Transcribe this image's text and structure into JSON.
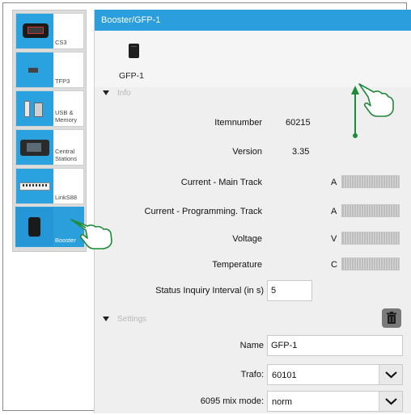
{
  "sidebar": {
    "items": [
      {
        "label": "CS3",
        "icon": "cs3-device-icon",
        "active": false
      },
      {
        "label": "TFP3",
        "icon": "tfp3-device-icon",
        "active": false
      },
      {
        "label": "USB & Memory",
        "icon": "usb-memory-icon",
        "active": false
      },
      {
        "label": "Central Stations",
        "icon": "central-station-icon",
        "active": false
      },
      {
        "label": "LinkS88",
        "icon": "links88-icon",
        "active": false
      },
      {
        "label": "Booster",
        "icon": "booster-icon",
        "active": true
      }
    ]
  },
  "header": {
    "title": "Booster/GFP-1"
  },
  "device": {
    "name": "GFP-1"
  },
  "info": {
    "section_label": "Info",
    "itemnumber_label": "Itemnumber",
    "itemnumber_value": "60215",
    "version_label": "Version",
    "version_value": "3.35",
    "current_main_label": "Current - Main Track",
    "current_main_unit": "A",
    "current_prog_label": "Current - Programming. Track",
    "current_prog_unit": "A",
    "voltage_label": "Voltage",
    "voltage_unit": "V",
    "temperature_label": "Temperature",
    "temperature_unit": "C",
    "status_interval_label": "Status Inquiry Interval (in s)",
    "status_interval_value": "5"
  },
  "settings": {
    "section_label": "Settings",
    "name_label": "Name",
    "name_value": "GFP-1",
    "trafo_label": "Trafo:",
    "trafo_value": "60101",
    "mix_label": "6095 mix mode:",
    "mix_value": "norm"
  },
  "colors": {
    "accent": "#2b9ede",
    "annotation": "#1f8a3a"
  }
}
